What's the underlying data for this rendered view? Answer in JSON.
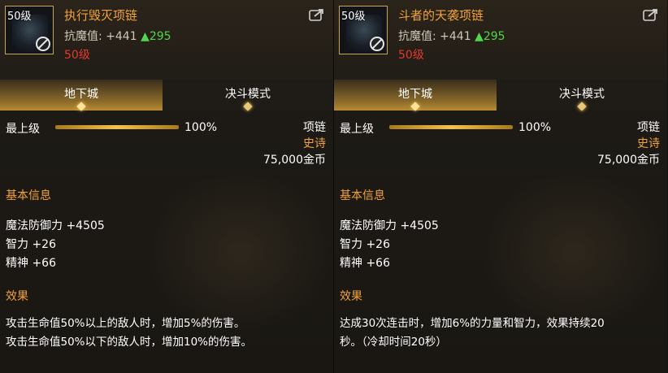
{
  "items": [
    {
      "level_badge": "50级",
      "name": "执行毁灭项链",
      "stat_label": "抗魔值: +441",
      "stat_delta": "▲295",
      "required_level": "50级",
      "tabs": [
        "地下城",
        "决斗模式"
      ],
      "upgrade_label": "最上级",
      "upgrade_percent": "100%",
      "upgrade_fraction": 1.0,
      "slot": "项链",
      "rarity": "史诗",
      "price": "75,000金币",
      "basic_info_title": "基本信息",
      "stats": [
        "魔法防御力 +4505",
        "智力 +26",
        "精神 +66"
      ],
      "effect_title": "效果",
      "effect_lines": [
        "攻击生命值50%以上的敌人时，增加5%的伤害。",
        "攻击生命值50%以下的敌人时，增加10%的伤害。"
      ]
    },
    {
      "level_badge": "50级",
      "name": "斗者的天袭项链",
      "stat_label": "抗魔值: +441",
      "stat_delta": "▲295",
      "required_level": "50级",
      "tabs": [
        "地下城",
        "决斗模式"
      ],
      "upgrade_label": "最上级",
      "upgrade_percent": "100%",
      "upgrade_fraction": 1.0,
      "slot": "项链",
      "rarity": "史诗",
      "price": "75,000金币",
      "basic_info_title": "基本信息",
      "stats": [
        "魔法防御力 +4505",
        "智力 +26",
        "精神 +66"
      ],
      "effect_title": "效果",
      "effect_lines": [
        "达成30次连击时，增加6%的力量和智力，效果持续20",
        "秒。（冷却时间20秒）"
      ]
    }
  ],
  "icons": {
    "ban": "prohibited-icon",
    "share": "share-icon",
    "tab_marker": "diamond-icon"
  },
  "colors": {
    "title": "#f2a33a",
    "positive": "#4fd64a",
    "requirement": "#e43a2e",
    "rarity": "#f2a33a"
  }
}
